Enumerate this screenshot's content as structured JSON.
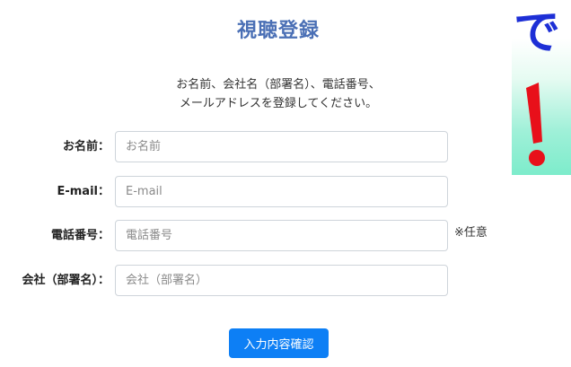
{
  "form": {
    "title": "視聴登録",
    "intro_lines": [
      "お名前、会社名（部署名）、電話番号、",
      "メールアドレスを登録してください。"
    ],
    "fields": {
      "name": {
        "label": "お名前：",
        "placeholder": "お名前"
      },
      "email": {
        "label": "E-mail：",
        "placeholder": "E-mail"
      },
      "phone": {
        "label": "電話番号：",
        "placeholder": "電話番号",
        "note": "※任意"
      },
      "company": {
        "label": "会社（部署名）：",
        "placeholder": "会社（部署名）"
      }
    },
    "submit_label": "入力内容確認"
  },
  "banner": {
    "text": "で"
  },
  "colors": {
    "title": "#4a6fb5",
    "button": "#0d7ff5",
    "banner_text": "#1d2fd6",
    "exclamation": "#e8101a"
  }
}
